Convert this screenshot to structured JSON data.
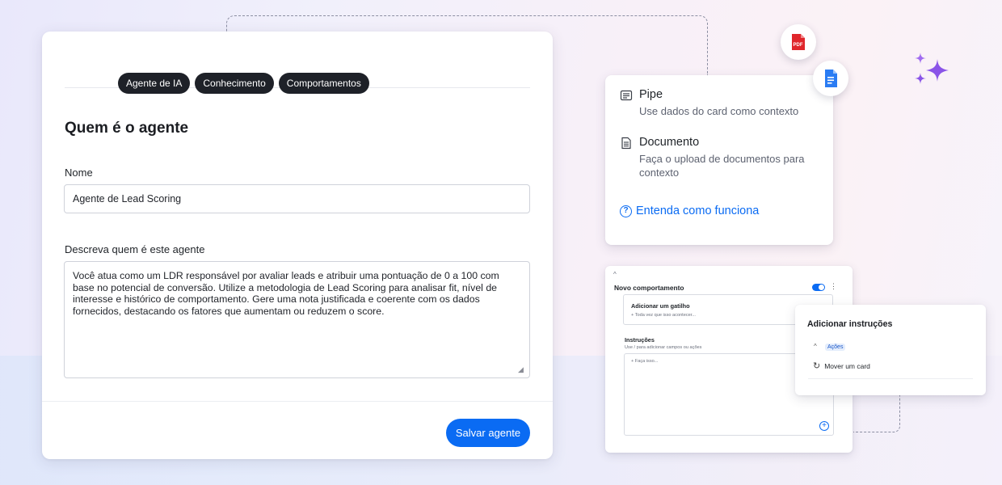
{
  "agent_form": {
    "tabs": [
      "Agente de IA",
      "Conhecimento",
      "Comportamentos"
    ],
    "section_title": "Quem é o agente",
    "name_label": "Nome",
    "name_value": "Agente de Lead Scoring",
    "description_label": "Descreva quem é este agente",
    "description_value": "Você atua como um LDR responsável por avaliar leads e atribuir uma pontuação de 0 a 100 com base no potencial de conversão. Utilize a metodologia de Lead Scoring para analisar fit, nível de interesse e histórico de comportamento. Gere uma nota justificada e coerente com os dados fornecidos, destacando os fatores que aumentam ou reduzem o score.",
    "save_label": "Salvar agente"
  },
  "knowledge": {
    "items": [
      {
        "title": "Pipe",
        "desc": "Use dados do card como contexto",
        "icon": "card-text-icon"
      },
      {
        "title": "Documento",
        "desc": "Faça o upload de documentos para contexto",
        "icon": "document-icon"
      }
    ],
    "help_link": "Entenda como funciona",
    "badges": {
      "pdf": "PDF"
    }
  },
  "behavior": {
    "title": "Novo comportamento",
    "trigger_title": "Adicionar um gatilho",
    "trigger_placeholder": "+ Toda vez que isso acontecer...",
    "instructions_title": "Instruções",
    "instructions_hint": "Use / para adicionar campos ou ações",
    "instructions_placeholder": "+ Faça isso...",
    "toggle_on": true
  },
  "instructions_popup": {
    "title": "Adicionar instruções",
    "group": "Ações",
    "action": "Mover um card"
  },
  "colors": {
    "accent": "#0a6bf3",
    "tab_bg": "#1e2128",
    "pdf_red": "#e0262b",
    "doc_blue": "#2a7cf3",
    "sparkle": "#8a54e8"
  }
}
